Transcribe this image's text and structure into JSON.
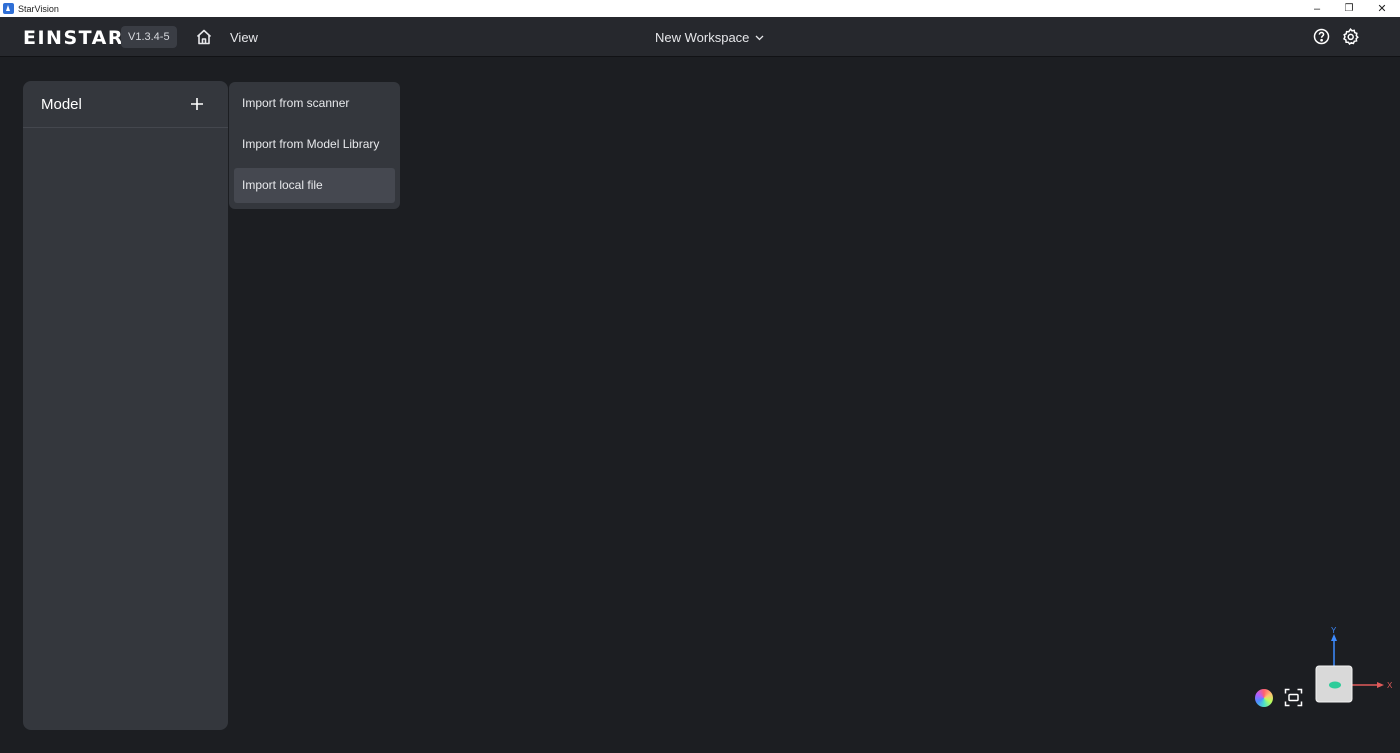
{
  "window": {
    "title": "StarVision",
    "controls": {
      "minimize": "–",
      "restore": "❐",
      "close": "✕"
    }
  },
  "topbar": {
    "logo": "EINSTAR",
    "version": "V1.3.4-5",
    "home_icon": "home-icon",
    "view_label": "View",
    "workspace_label": "New Workspace",
    "help_icon": "help-icon",
    "settings_icon": "gear-icon"
  },
  "model_panel": {
    "title": "Model",
    "add_icon": "plus-icon"
  },
  "import_menu": {
    "items": [
      {
        "label": "Import from scanner"
      },
      {
        "label": "Import from Model Library"
      },
      {
        "label": "Import local file"
      }
    ],
    "highlighted": "Import local file"
  },
  "viewport": {
    "axes": {
      "y_label": "Y",
      "x_label": "X"
    },
    "colors": {
      "x_axis": "#e05a5a",
      "y_axis": "#3d8bff",
      "accent_model": "#2ecc9a"
    }
  }
}
